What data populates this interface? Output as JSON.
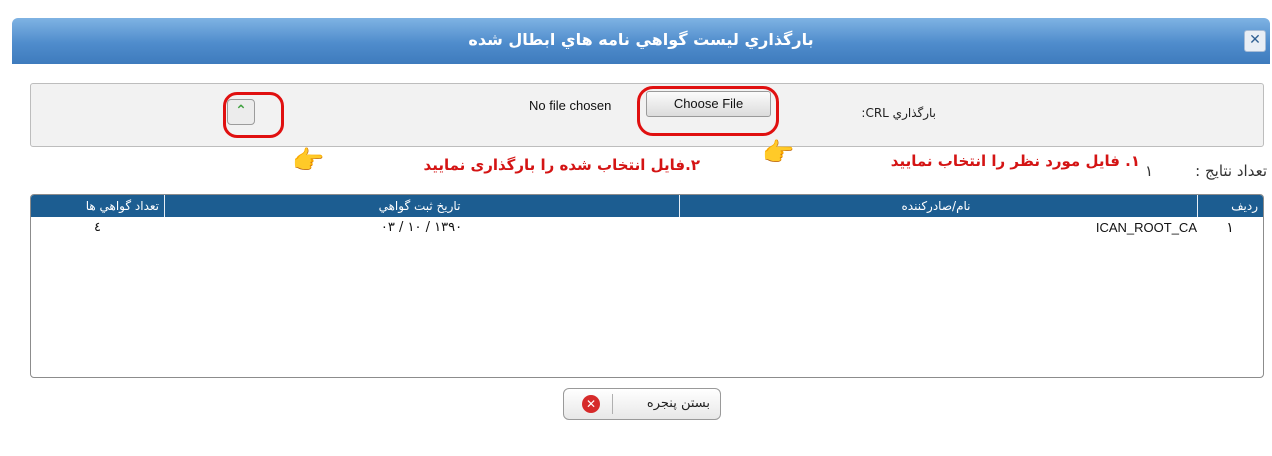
{
  "dialog": {
    "title": "بارگذاري ليست گواهي نامه هاي ابطال شده",
    "close_icon": "close-icon"
  },
  "upload": {
    "crl_label": "بارگذاري CRL:",
    "choose_button": "Choose File",
    "file_status": "No file chosen",
    "upload_icon": "upload-chevron-icon"
  },
  "annotations": {
    "step1": "۱. فایل مورد نظر را انتخاب نمایید",
    "step2": "۲.فایل انتخاب شده را بارگذاری نمایید",
    "pointer_icon": "pointing-hand-icon",
    "highlight_color": "#e01010"
  },
  "results": {
    "count_label": "تعداد نتايج :",
    "count_value": "١"
  },
  "grid": {
    "header_color": "#1c5d91",
    "columns": [
      "رديف",
      "نام/صادرکننده",
      "تاريخ ثبت گواهي",
      "تعداد گواهي ها"
    ],
    "rows": [
      {
        "index": "١",
        "issuer": "ICAN_ROOT_CA",
        "date": "١٣٩٠ / ١٠ / ٠٣",
        "count": "٤"
      }
    ]
  },
  "footer": {
    "close_window_label": "بستن پنجره",
    "close_window_icon": "close-circle-icon"
  }
}
